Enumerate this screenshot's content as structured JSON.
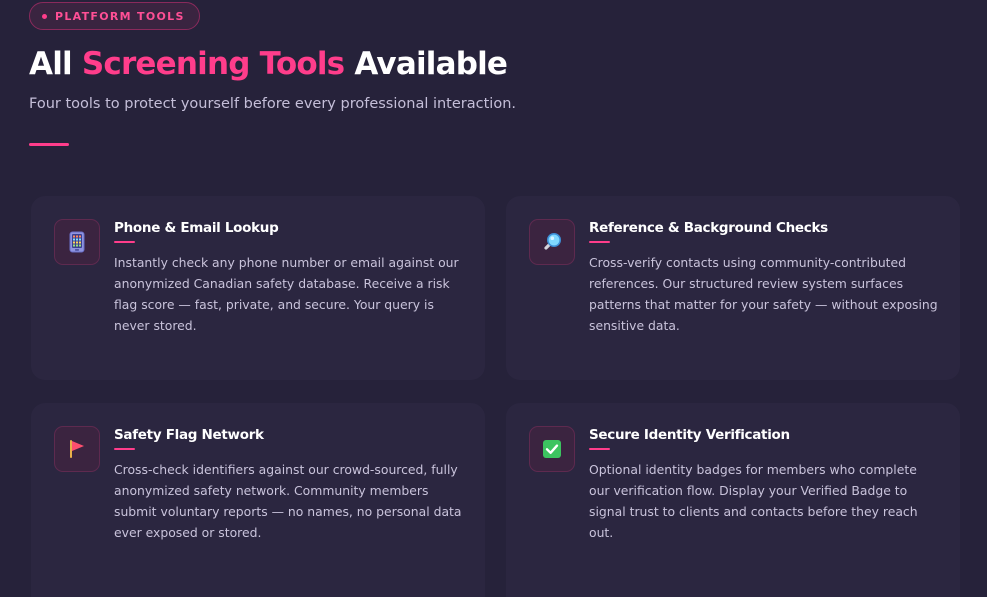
{
  "badge": {
    "label": "PLATFORM TOOLS"
  },
  "heading": {
    "part1": "All ",
    "accent": "Screening Tools",
    "part2": " Available"
  },
  "subtitle": "Four tools to protect yourself before every professional interaction.",
  "colors": {
    "background": "#26223a",
    "card": "#2b2640",
    "accent": "#ff3d8b",
    "text": "#ffffff",
    "muted": "#c9c3db"
  },
  "tools": [
    {
      "icon": "phone-icon",
      "title": "Phone & Email Lookup",
      "description": "Instantly check any phone number or email against our anonymized Canadian safety database. Receive a risk flag score — fast, private, and secure. Your query is never stored."
    },
    {
      "icon": "magnifier-icon",
      "title": "Reference & Background Checks",
      "description": "Cross-verify contacts using community-contributed references. Our structured review system surfaces patterns that matter for your safety — without exposing sensitive data."
    },
    {
      "icon": "flag-icon",
      "title": "Safety Flag Network",
      "description": "Cross-check identifiers against our crowd-sourced, fully anonymized safety network. Community members submit voluntary reports — no names, no personal data ever exposed or stored."
    },
    {
      "icon": "checkbox-icon",
      "title": "Secure Identity Verification",
      "description": "Optional identity badges for members who complete our verification flow. Display your Verified Badge to signal trust to clients and contacts before they reach out."
    }
  ]
}
